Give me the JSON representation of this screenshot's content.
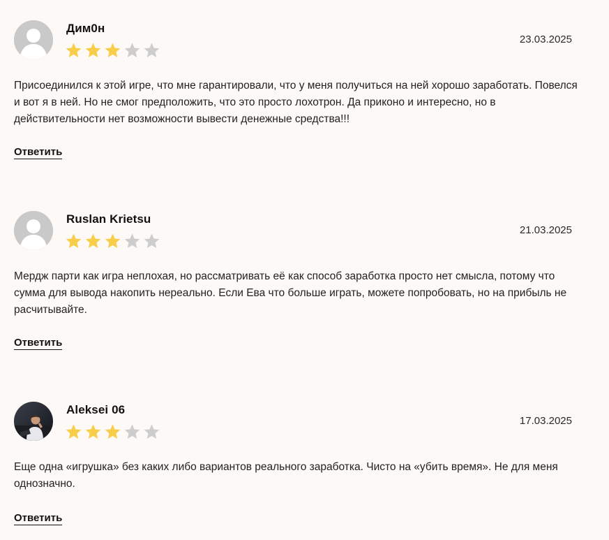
{
  "colors": {
    "star_filled": "#f7cd4a",
    "star_empty": "#cdcdcd",
    "avatar_placeholder": "#c9c9c9",
    "background": "#fdf9f6"
  },
  "reviews": [
    {
      "author": "Дим0н",
      "rating": 3,
      "max_rating": 5,
      "date": "23.03.2025",
      "avatar": "default-avatar-icon",
      "text": "Присоединился к этой игре, что мне гарантировали, что у меня получиться на ней хорошо заработать. Повелся и вот я в ней. Но не смог предположить, что это просто лохотрон. Да приконо и интересно, но в действительности нет возможности вывести денежные средства!!!",
      "reply_label": "Ответить"
    },
    {
      "author": "Ruslan Krietsu",
      "rating": 3,
      "max_rating": 5,
      "date": "21.03.2025",
      "avatar": "default-avatar-icon",
      "text": "Мердж парти как игра неплохая, но рассматривать её как способ заработка просто нет смысла, потому что сумма для вывода накопить нереально. Если Ева что больше играть, можете попробовать, но на прибыль не расчитывайте.",
      "reply_label": "Ответить"
    },
    {
      "author": "Aleksei 06",
      "rating": 3,
      "max_rating": 5,
      "date": "17.03.2025",
      "avatar": "user-photo-avatar",
      "text": "Еще одна «игрушка» без каких либо вариантов реального заработка. Чисто на «убить время». Не для меня однозначно.",
      "reply_label": "Ответить"
    }
  ]
}
